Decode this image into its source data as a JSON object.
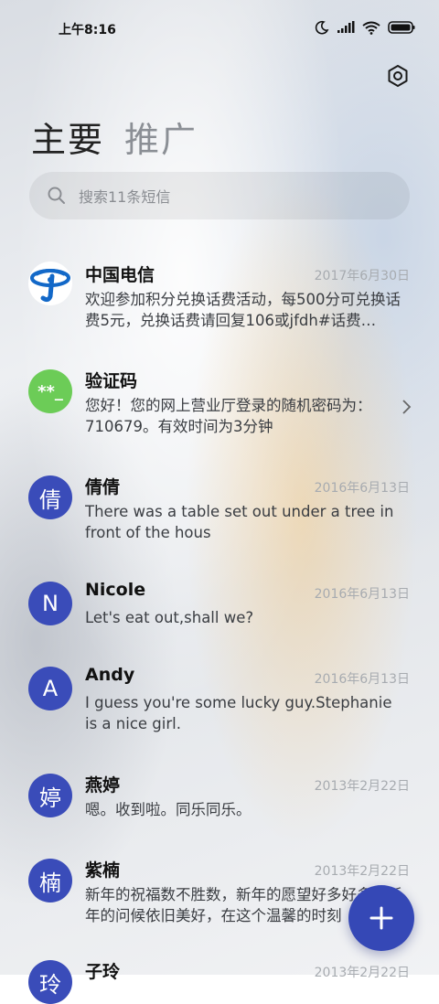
{
  "status_bar": {
    "time": "上午8:16"
  },
  "tabs": [
    {
      "label": "主要"
    },
    {
      "label": "推广"
    }
  ],
  "search": {
    "placeholder": "搜索11条短信"
  },
  "colors": {
    "accent": "#3548b6",
    "avatar_blue": "#3a4cb9",
    "code_green": "#6ccc57",
    "telecom_blue": "#1268c8"
  },
  "messages": [
    {
      "sender": "中国电信",
      "date": "2017年6月30日",
      "preview": "欢迎参加积分兑换话费活动，每500分可兑换话费5元，兑换话费请回复106或jfdh#话费…",
      "avatar": "china-telecom-logo"
    },
    {
      "sender": "验证码",
      "date": "",
      "preview": "您好！您的网上营业厅登录的随机密码为：710679。有效时间为3分钟",
      "avatar": "**_"
    },
    {
      "sender": "倩倩",
      "date": "2016年6月13日",
      "preview": "There was a table set out under a tree in front of the hous",
      "avatar": "倩"
    },
    {
      "sender": "Nicole",
      "date": "2016年6月13日",
      "preview": "Let's eat out,shall we?",
      "avatar": "N"
    },
    {
      "sender": "Andy",
      "date": "2016年6月13日",
      "preview": "I guess you're some lucky guy.Stephanie is a nice girl.",
      "avatar": "A"
    },
    {
      "sender": "燕婷",
      "date": "2013年2月22日",
      "preview": "嗯。收到啦。同乐同乐。",
      "avatar": "婷"
    },
    {
      "sender": "紫楠",
      "date": "2013年2月22日",
      "preview": "新年的祝福数不胜数，新年的愿望好多好多，新年的问候依旧美好，在这个温馨的时刻",
      "avatar": "楠"
    },
    {
      "sender": "子玲",
      "date": "2013年2月22日",
      "preview": "",
      "avatar": "玲"
    }
  ]
}
